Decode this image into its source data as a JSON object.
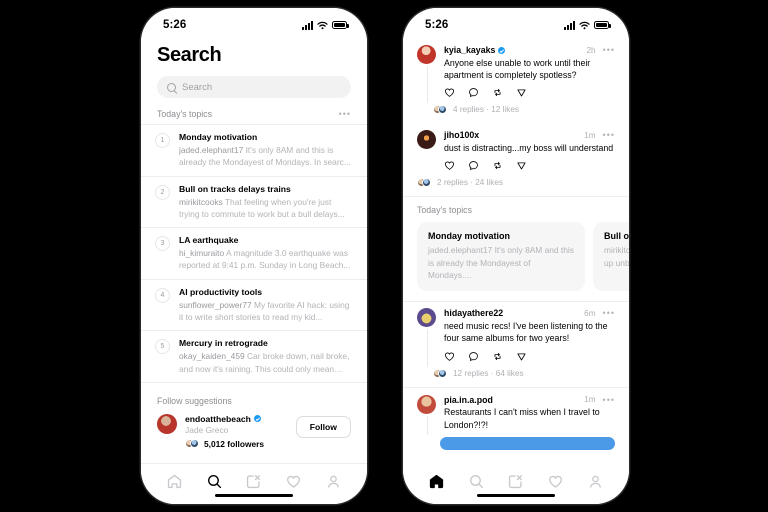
{
  "statusbar": {
    "time": "5:26"
  },
  "left_phone": {
    "page_title": "Search",
    "search": {
      "placeholder": "Search"
    },
    "topics_section": {
      "label": "Today's topics",
      "more_icon": "•••"
    },
    "topics": [
      {
        "rank": "1",
        "title": "Monday motivation",
        "author": "jaded.elephant17",
        "snippet": "It's only 8AM and this is already the Mondayest of Mondays. In searc..."
      },
      {
        "rank": "2",
        "title": "Bull on tracks delays trains",
        "author": "mirikitcooks",
        "snippet": "That feeling when you're just trying to commute to work but a bull delays..."
      },
      {
        "rank": "3",
        "title": "LA earthquake",
        "author": "hi_kimuraito",
        "snippet": "A magnitude 3.0 earthquake was reported at 9:41 p.m. Sunday in Long Beach..."
      },
      {
        "rank": "4",
        "title": "AI productivity tools",
        "author": "sunflower_power77",
        "snippet": "My favorite AI hack: using it to write short stories to read my kid..."
      },
      {
        "rank": "5",
        "title": "Mercury in retrograde",
        "author": "okay_kaiden_459",
        "snippet": "Car broke down, nail broke, and now it's raining. This could only mean on..."
      }
    ],
    "follow_section": {
      "label": "Follow suggestions",
      "username": "endoatthebeach",
      "fullname": "Jade Greco",
      "followers": "5,012 followers",
      "follow_button": "Follow"
    },
    "tabs": [
      {
        "name": "home",
        "icon": "home-icon",
        "active": false
      },
      {
        "name": "search",
        "icon": "search-icon",
        "active": true
      },
      {
        "name": "compose",
        "icon": "compose-icon",
        "active": false
      },
      {
        "name": "activity",
        "icon": "heart-icon",
        "active": false
      },
      {
        "name": "profile",
        "icon": "person-icon",
        "active": false
      }
    ]
  },
  "right_phone": {
    "posts": [
      {
        "user": "kyia_kayaks",
        "verified": true,
        "time": "2h",
        "text": "Anyone else unable to work until their apartment is completely spotless?",
        "stats": "4 replies · 12 likes",
        "thread": true
      },
      {
        "user": "jiho100x",
        "verified": false,
        "time": "1m",
        "text": "dust is distracting...my boss will understand",
        "stats": "2 replies · 24 likes",
        "thread": false
      },
      {
        "user": "hidayathere22",
        "verified": false,
        "time": "6m",
        "text": "need music recs! I've been listening to the four same albums for two years!",
        "stats": "12 replies · 64 likes",
        "thread": true
      },
      {
        "user": "pia.in.a.pod",
        "verified": false,
        "time": "1m",
        "text": "Restaurants I can't miss when I travel to London?!?!",
        "stats": "",
        "thread": true
      }
    ],
    "topics_strip": {
      "label": "Today's topics",
      "cards": [
        {
          "title": "Monday motivation",
          "author": "jaded.elephant17",
          "snippet": "It's only 8AM and this is already the Mondayest of Mondays...."
        },
        {
          "title": "Bull on",
          "author": "mirikitc",
          "snippet": "up unb"
        }
      ]
    },
    "tabs": [
      {
        "name": "home",
        "icon": "home-icon",
        "active": true
      },
      {
        "name": "search",
        "icon": "search-icon",
        "active": false
      },
      {
        "name": "compose",
        "icon": "compose-icon",
        "active": false
      },
      {
        "name": "activity",
        "icon": "heart-icon",
        "active": false
      },
      {
        "name": "profile",
        "icon": "person-icon",
        "active": false
      }
    ]
  },
  "colors": {
    "accent_blue": "#1d9bf0",
    "link_bar": "#4a9ae8",
    "background": "#000000"
  }
}
